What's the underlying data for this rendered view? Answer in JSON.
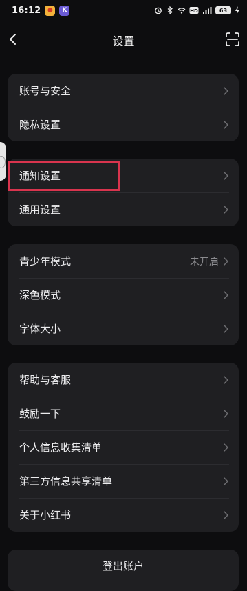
{
  "status_bar": {
    "time": "16:12",
    "app_badges": [
      "weibo-icon",
      "k-app-icon"
    ],
    "battery": "63",
    "icons": [
      "alarm-icon",
      "bluetooth-icon",
      "wifi-icon",
      "hd-icon",
      "signal-icon",
      "charging-icon"
    ]
  },
  "nav": {
    "title": "设置",
    "back_icon": "back-chevron-icon",
    "scan_icon": "scan-icon"
  },
  "groups": [
    {
      "items": [
        {
          "label": "账号与安全"
        },
        {
          "label": "隐私设置"
        }
      ]
    },
    {
      "items": [
        {
          "label": "通知设置"
        },
        {
          "label": "通用设置"
        }
      ]
    },
    {
      "items": [
        {
          "label": "青少年模式",
          "value": "未开启"
        },
        {
          "label": "深色模式"
        },
        {
          "label": "字体大小"
        }
      ]
    },
    {
      "items": [
        {
          "label": "帮助与客服"
        },
        {
          "label": "鼓励一下"
        },
        {
          "label": "个人信息收集清单"
        },
        {
          "label": "第三方信息共享清单"
        },
        {
          "label": "关于小红书"
        }
      ]
    }
  ],
  "logout": {
    "label": "登出账户"
  },
  "colors": {
    "background": "#0d0d0f",
    "card": "#1f1f22",
    "highlight": "#d9344e"
  }
}
